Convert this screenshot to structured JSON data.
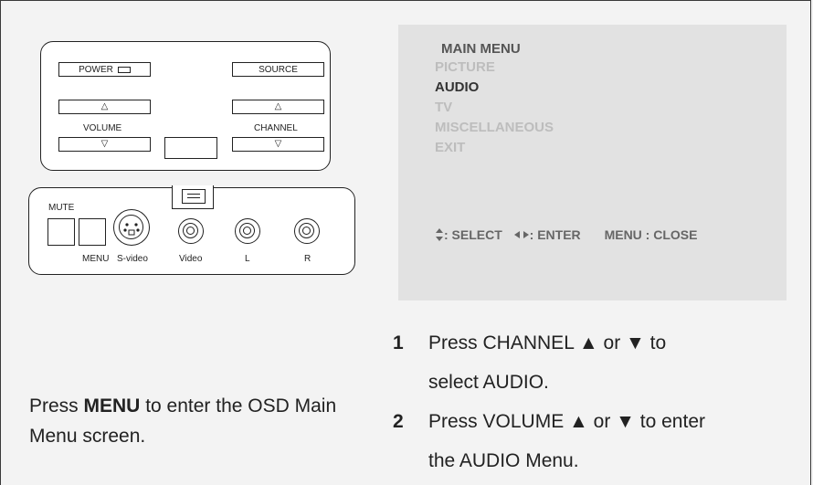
{
  "remote": {
    "power": "POWER",
    "source": "SOURCE",
    "volume": "VOLUME",
    "channel": "CHANNEL",
    "up_symbol": "△",
    "down_symbol": "▽",
    "mute": "MUTE",
    "menu": "MENU",
    "svideo": "S-video",
    "video": "Video",
    "left": "L",
    "right": "R"
  },
  "osd": {
    "title": "MAIN MENU",
    "items": [
      "PICTURE",
      "AUDIO",
      "TV",
      "MISCELLANEOUS",
      "EXIT"
    ],
    "selected": "AUDIO",
    "footer": {
      "select_icon": "up-down-arrows-icon",
      "select": ": SELECT",
      "enter_icon": "left-right-arrows-icon",
      "enter": ": ENTER",
      "close": "MENU : CLOSE"
    },
    "colors": {
      "title": "#555555",
      "selected": "#333333",
      "dim": "#bdbdbd",
      "background": "#e2e2e2"
    }
  },
  "caption": {
    "pre": "Press ",
    "bold": "MENU",
    "post": " to enter the OSD Main Menu screen."
  },
  "steps": [
    {
      "num": "1",
      "line1": "Press CHANNEL ▲ or ▼ to",
      "line2": "select AUDIO."
    },
    {
      "num": "2",
      "line1": "Press VOLUME ▲ or ▼ to enter",
      "line2": "the AUDIO Menu."
    }
  ]
}
